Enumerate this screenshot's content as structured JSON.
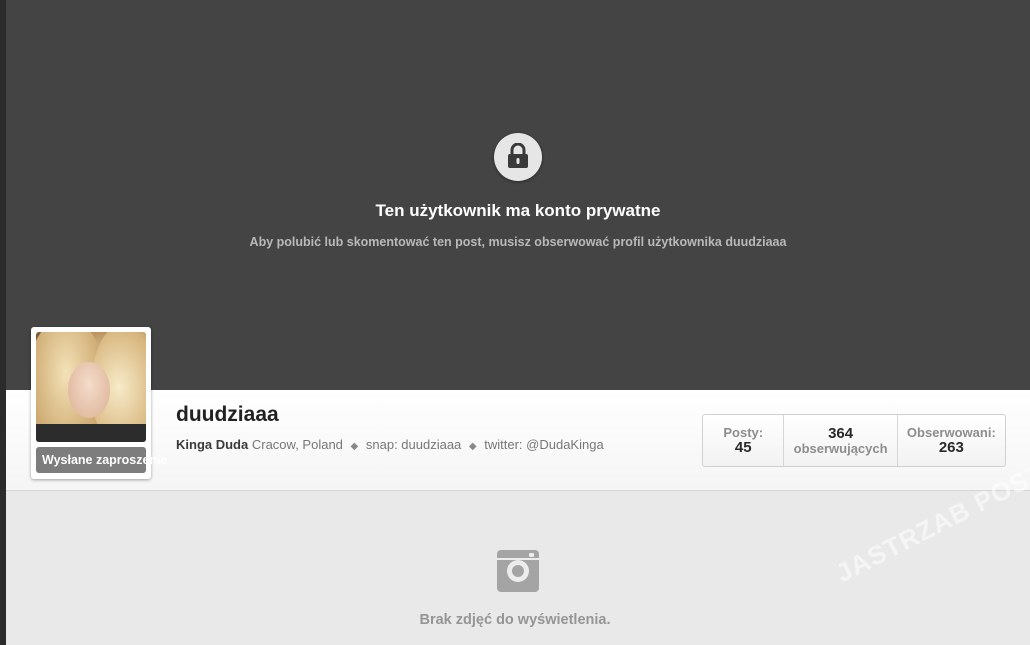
{
  "banner": {
    "title": "Ten użytkownik ma konto prywatne",
    "subtitle": "Aby polubić lub skomentować ten post, musisz obserwować profil użytkownika duudziaaa",
    "icon": "lock-icon"
  },
  "profile": {
    "username": "duudziaaa",
    "full_name": "Kinga Duda",
    "bio_parts": [
      "Cracow, Poland",
      "snap: duudziaaa",
      "twitter: @DudaKinga"
    ],
    "separator": "◆",
    "request_button": "Wysłane zaproszenie"
  },
  "stats": [
    {
      "label": "Posty:",
      "value": "45"
    },
    {
      "label": "obserwujących",
      "value": "364"
    },
    {
      "label": "Obserwowani:",
      "value": "263"
    }
  ],
  "empty_state": {
    "icon": "camera-icon",
    "text": "Brak zdjęć do wyświetlenia."
  },
  "watermark": "JASTRZAB POST",
  "colors": {
    "banner_bg": "#444444",
    "page_bg": "#e9e9e9",
    "button_bg": "#7d7d7d"
  }
}
